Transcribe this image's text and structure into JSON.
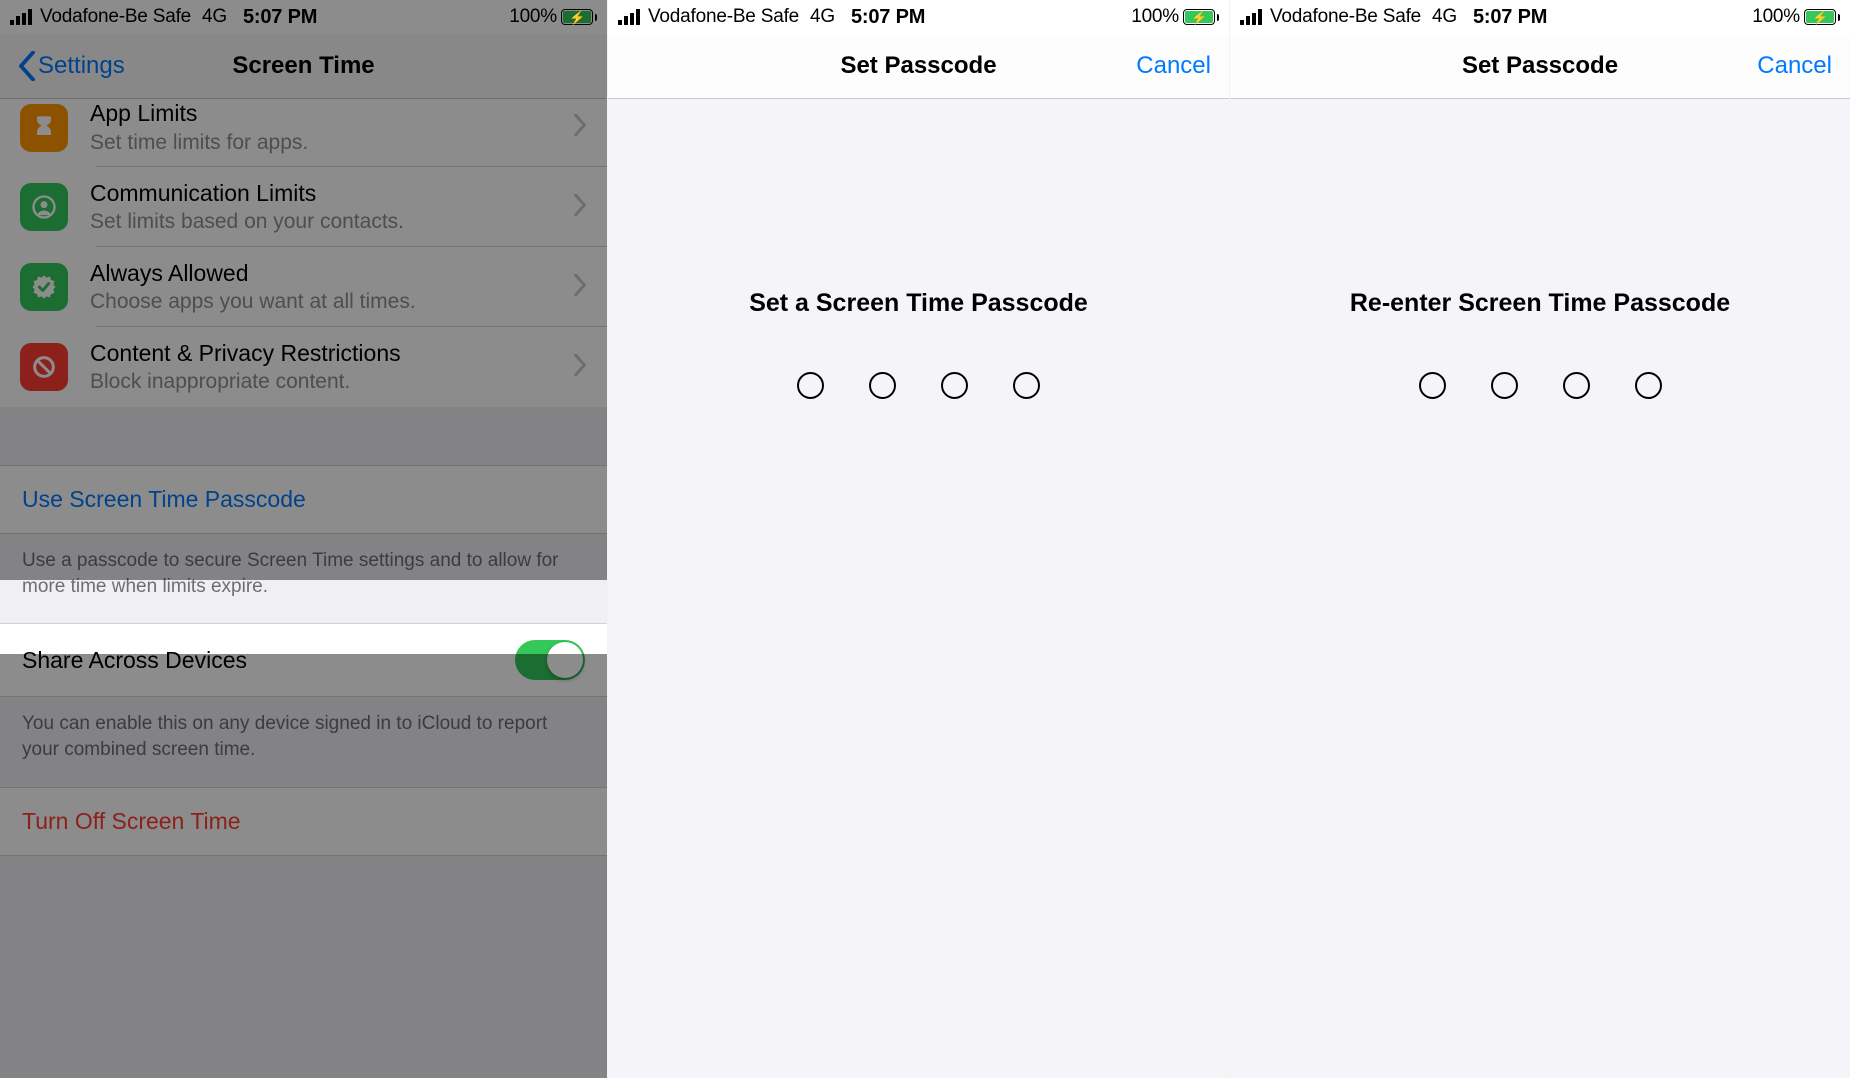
{
  "status": {
    "carrier": "Vodafone-Be Safe",
    "network": "4G",
    "time": "5:07 PM",
    "battery_pct": "100%"
  },
  "screen1": {
    "back_label": "Settings",
    "title": "Screen Time",
    "rows": [
      {
        "title": "App Limits",
        "sub": "Set time limits for apps."
      },
      {
        "title": "Communication Limits",
        "sub": "Set limits based on your contacts."
      },
      {
        "title": "Always Allowed",
        "sub": "Choose apps you want at all times."
      },
      {
        "title": "Content & Privacy Restrictions",
        "sub": "Block inappropriate content."
      }
    ],
    "use_passcode": "Use Screen Time Passcode",
    "use_passcode_note": "Use a passcode to secure Screen Time settings and to allow for more time when limits expire.",
    "share_label": "Share Across Devices",
    "share_note": "You can enable this on any device signed in to iCloud to report your combined screen time.",
    "turn_off": "Turn Off Screen Time"
  },
  "screen2": {
    "nav_title": "Set Passcode",
    "cancel": "Cancel",
    "prompt": "Set a Screen Time Passcode"
  },
  "screen3": {
    "nav_title": "Set Passcode",
    "cancel": "Cancel",
    "prompt": "Re-enter Screen Time Passcode"
  }
}
